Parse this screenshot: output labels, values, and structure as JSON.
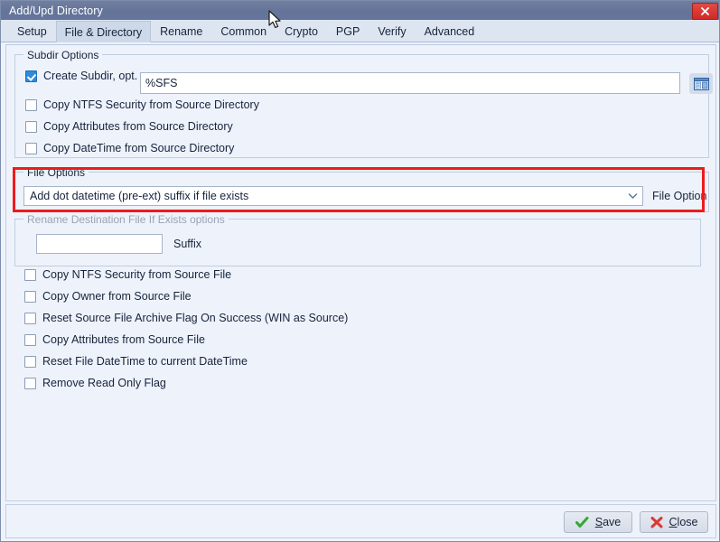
{
  "window": {
    "title": "Add/Upd Directory",
    "close_icon": "close-x-icon"
  },
  "tabs": [
    {
      "label": "Setup",
      "active": false
    },
    {
      "label": "File & Directory",
      "active": true
    },
    {
      "label": "Rename",
      "active": false
    },
    {
      "label": "Common",
      "active": false
    },
    {
      "label": "Crypto",
      "active": false
    },
    {
      "label": "PGP",
      "active": false
    },
    {
      "label": "Verify",
      "active": false
    },
    {
      "label": "Advanced",
      "active": false
    }
  ],
  "subdir_options": {
    "title": "Subdir Options",
    "create_subdir": {
      "label": "Create Subdir, opt.",
      "checked": true
    },
    "path_value": "%SFS",
    "path_placeholder": "",
    "browse_icon": "browse-folder-icon",
    "checkboxes": [
      {
        "label": "Copy NTFS Security from Source Directory",
        "checked": false
      },
      {
        "label": "Copy Attributes from Source Directory",
        "checked": false
      },
      {
        "label": "Copy DateTime from Source Directory",
        "checked": false
      }
    ]
  },
  "file_options": {
    "title": "File Options",
    "selected": "Add dot datetime (pre-ext) suffix if file exists",
    "side_label": "File Option",
    "arrow_icon": "chevron-down-icon",
    "highlight_color": "#ee1b1b"
  },
  "rename_options": {
    "title": "Rename Destination File If Exists options",
    "disabled": true,
    "suffix_value": "",
    "suffix_placeholder": "",
    "suffix_label": "Suffix"
  },
  "file_checkboxes": [
    {
      "label": "Copy NTFS Security from Source File",
      "checked": false
    },
    {
      "label": "Copy Owner from Source File",
      "checked": false
    },
    {
      "label": "Reset Source File Archive Flag On Success (WIN as Source)",
      "checked": false
    },
    {
      "label": "Copy Attributes from Source File",
      "checked": false
    },
    {
      "label": "Reset File DateTime to current DateTime",
      "checked": false
    },
    {
      "label": "Remove Read Only Flag",
      "checked": false
    }
  ],
  "footer": {
    "save": {
      "accel": "S",
      "rest": "ave",
      "icon": "green-check-icon"
    },
    "close": {
      "accel": "C",
      "rest": "lose",
      "icon": "red-x-icon"
    }
  },
  "colors": {
    "titlebar": "#65759a",
    "page_bg": "#eef2fb",
    "accent_checkbox": "#2d8bdd",
    "highlight": "#ee1b1b",
    "save_icon": "#34a834",
    "close_icon": "#d93a33"
  }
}
